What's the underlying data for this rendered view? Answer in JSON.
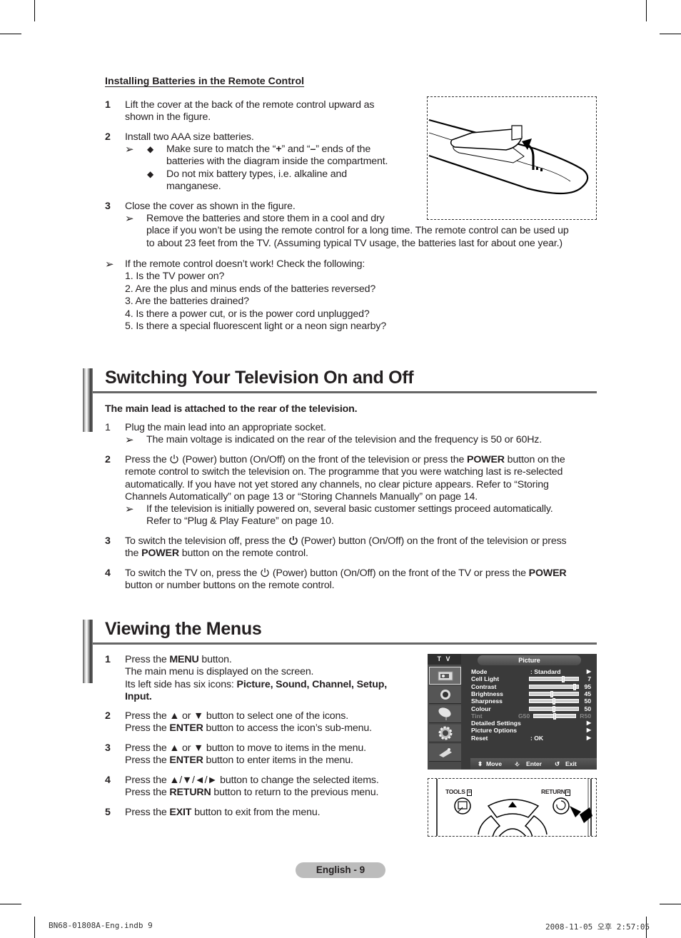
{
  "batteries": {
    "heading": "Installing Batteries in the Remote Control",
    "steps": [
      {
        "num": "1",
        "lines": [
          "Lift the cover at the back of the remote control upward as",
          "shown in the figure."
        ]
      },
      {
        "num": "2",
        "text": "Install two AAA size batteries.",
        "bullets": [
          [
            "Make sure to match the “",
            "+",
            "” and “",
            "–",
            "” ends of the",
            "batteries with the diagram inside the compartment."
          ],
          [
            "Do not mix battery types, i.e. alkaline and",
            "manganese."
          ]
        ]
      },
      {
        "num": "3",
        "text": "Close the cover as shown in the figure.",
        "note": [
          "Remove the batteries and store them in a cool and dry",
          "place if you won’t be using the remote control for a long time. The remote control can be used up",
          "to about 23 feet from the TV. (Assuming typical TV usage, the batteries last for about one year.)"
        ]
      }
    ],
    "check_note": {
      "intro": "If the remote control doesn’t work! Check the following:",
      "items": [
        "1. Is the TV power on?",
        "2. Are the plus and minus ends of the batteries reversed?",
        "3. Are the batteries drained?",
        "4. Is there a power cut, or is the power cord unplugged?",
        "5. Is there a special fluorescent light or a neon sign nearby?"
      ]
    }
  },
  "switching": {
    "title": "Switching Your Television On and Off",
    "lead": "The main lead is attached to the rear of the television.",
    "step1": {
      "num": "1",
      "text": "Plug the main lead into an appropriate socket.",
      "note": "The main voltage is indicated on the rear of the television and the frequency is 50 or 60Hz."
    },
    "step2": {
      "num": "2",
      "l1a": "Press the",
      "l1b": "(Power) button (On/Off) on the front of the television or press the",
      "l1c": "POWER",
      "l1d": "button on the",
      "l2": "remote control to switch the television on. The programme that you were watching last is re-selected",
      "l3": "automatically. If you have not yet stored any channels, no clear picture appears. Refer to “Storing",
      "l4": "Channels Automatically” on page 13 or “Storing Channels Manually” on page 14.",
      "note1": "If the television is initially powered on, several basic customer settings proceed automatically.",
      "note2": "Refer to “Plug & Play Feature” on page 10."
    },
    "step3": {
      "num": "3",
      "l1a": "To switch the television off, press the",
      "l1b": "(Power) button (On/Off) on the front of the television or press",
      "l2a": "the",
      "l2b": "POWER",
      "l2c": "button on the remote control."
    },
    "step4": {
      "num": "4",
      "l1a": "To switch the TV on, press the",
      "l1b": "(Power) button (On/Off) on the front of the TV or press the",
      "l1c": "POWER",
      "l2": "button or number buttons on the remote control."
    }
  },
  "menus": {
    "title": "Viewing the Menus",
    "steps": [
      {
        "num": "1",
        "a": "Press the",
        "b": "MENU",
        "c": "button.",
        "l2": "The main menu is displayed on the screen.",
        "l3a": "Its left side has six icons:",
        "l3b": "Picture, Sound, Channel, Setup,",
        "l4": "Input."
      },
      {
        "num": "2",
        "a": "Press the ▲ or ▼ button to select one of the icons.",
        "b1": "Press the",
        "b2": "ENTER",
        "b3": "button to access the icon’s sub-menu."
      },
      {
        "num": "3",
        "a": "Press the ▲ or ▼ button to move to items in the menu.",
        "b1": "Press the",
        "b2": "ENTER",
        "b3": "button to enter items in the menu."
      },
      {
        "num": "4",
        "a": "Press the ▲/▼/◄/► button to change the selected items.",
        "b1": "Press the",
        "b2": "RETURN",
        "b3": "button to return to the previous menu."
      },
      {
        "num": "5",
        "b1": "Press the",
        "b2": "EXIT",
        "b3": "button to exit from the menu."
      }
    ]
  },
  "tv_menu": {
    "tab": "T V",
    "header": "Picture",
    "icons": [
      "picture-icon",
      "sound-icon",
      "channel-icon",
      "setup-icon",
      "input-icon"
    ],
    "rows": [
      {
        "label": "Mode",
        "value": ": Standard",
        "arrow": "▶"
      },
      {
        "label": "Cell Light",
        "value": "7",
        "level": 0.7
      },
      {
        "label": "Contrast",
        "value": "95",
        "level": 0.95
      },
      {
        "label": "Brightness",
        "value": "45",
        "level": 0.45
      },
      {
        "label": "Sharpness",
        "value": "50",
        "level": 0.5
      },
      {
        "label": "Colour",
        "value": "50",
        "level": 0.5
      },
      {
        "label": "Tint",
        "left": "G50",
        "right": "R50",
        "level": 0.5,
        "disabled": true
      },
      {
        "label": "Detailed Settings",
        "arrow": "▶"
      },
      {
        "label": "Picture Options",
        "arrow": "▶"
      },
      {
        "label": "Reset",
        "value": ": OK",
        "arrow": "▶"
      }
    ],
    "footer": {
      "move": "Move",
      "enter": "Enter",
      "exit": "Exit"
    }
  },
  "remote_figure": {
    "tools": "TOOLS",
    "return": "RETURN"
  },
  "footer": {
    "page": "English - 9",
    "file": "BN68-01808A-Eng.indb   9",
    "timestamp": "2008-11-05   오후 2:57:05"
  }
}
